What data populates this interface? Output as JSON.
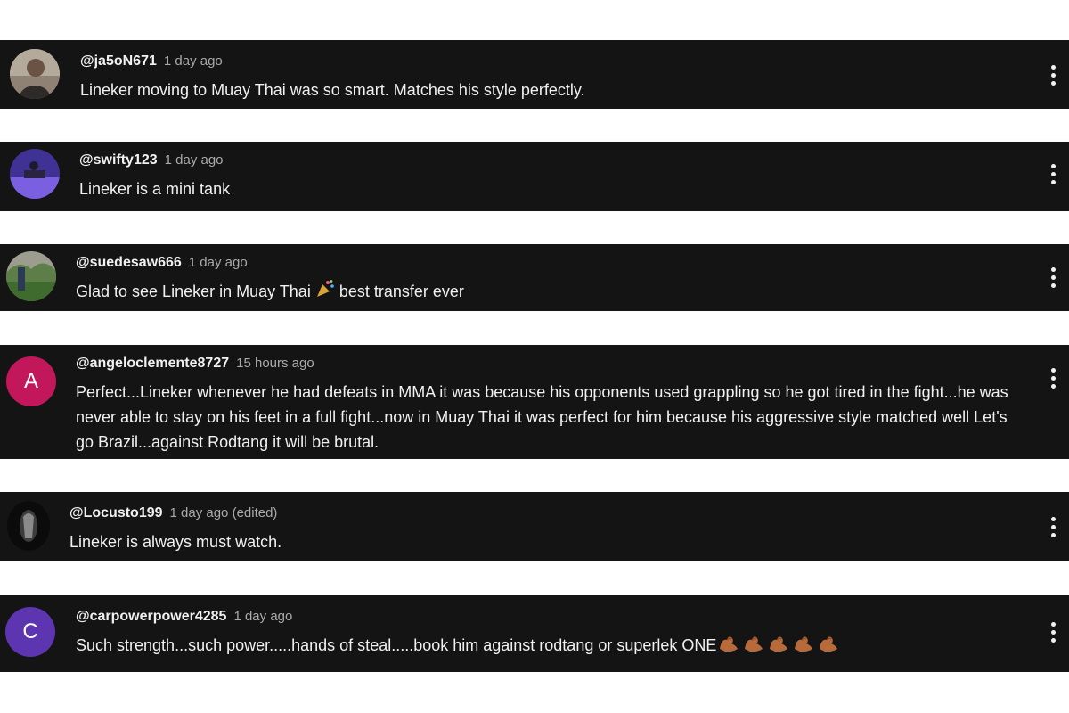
{
  "comments": [
    {
      "handle": "@ja5oN671",
      "time": "1 day ago",
      "text": "Lineker moving to Muay Thai was so smart. Matches his style perfectly.",
      "avatar_icon": "profile-photo-icon"
    },
    {
      "handle": "@swifty123",
      "time": "1 day ago",
      "text": "Lineker is a mini tank",
      "avatar_icon": "profile-photo-icon"
    },
    {
      "handle": "@suedesaw666",
      "time": "1 day ago",
      "text_before": "Glad to see Lineker in Muay Thai",
      "emoji": "party-popper-icon",
      "text_after": "best transfer ever",
      "avatar_icon": "profile-photo-icon"
    },
    {
      "handle": "@angeloclemente8727",
      "time": "15 hours ago",
      "text": "Perfect...Lineker whenever he had defeats in MMA it was because his opponents used grappling so he got tired in the fight...he was never able to stay on his feet in a full fight...now in Muay Thai it was perfect for him because his aggressive style matched well Let's go Brazil...against Rodtang it will be brutal.",
      "avatar_letter": "A",
      "avatar_color": "#c2185b"
    },
    {
      "handle": "@Locusto199",
      "time": "1 day ago (edited)",
      "text": "Lineker is always must watch.",
      "avatar_icon": "profile-photo-icon"
    },
    {
      "handle": "@carpowerpower4285",
      "time": "1 day ago",
      "text": "Such strength...such power.....hands of steal.....book him against rodtang or superlek ONE",
      "emoji": "flexed-biceps-icon",
      "emoji_count": 5,
      "avatar_letter": "C",
      "avatar_color": "#5e35b1"
    }
  ],
  "colors": {
    "comment_bg": "#141414",
    "page_bg": "#ffffff",
    "text": "#f1f1f1",
    "meta": "#aaaaaa"
  }
}
